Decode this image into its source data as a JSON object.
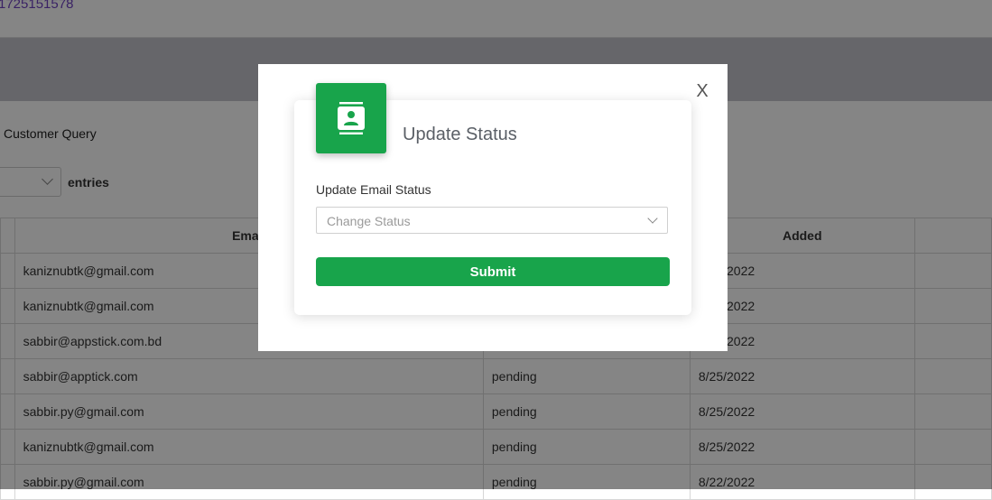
{
  "page": {
    "phone": "1725151578",
    "section_title": "Customer Query",
    "entries_label": "entries"
  },
  "table": {
    "headers": [
      "",
      "Email",
      "",
      "Added",
      ""
    ],
    "rows": [
      {
        "email": "kaniznubtk@gmail.com",
        "status": "",
        "added": "8/25/2022"
      },
      {
        "email": "kaniznubtk@gmail.com",
        "status": "",
        "added": "8/25/2022"
      },
      {
        "email": "sabbir@appstick.com.bd",
        "status": "",
        "added": "8/25/2022"
      },
      {
        "email": "sabbir@apptick.com",
        "status": "pending",
        "added": "8/25/2022"
      },
      {
        "email": "sabbir.py@gmail.com",
        "status": "pending",
        "added": "8/25/2022"
      },
      {
        "email": "kaniznubtk@gmail.com",
        "status": "pending",
        "added": "8/25/2022"
      },
      {
        "email": "sabbir.py@gmail.com",
        "status": "pending",
        "added": "8/22/2022"
      }
    ]
  },
  "modal": {
    "close_label": "X",
    "title": "Update Status",
    "field_label": "Update Email Status",
    "select_placeholder": "Change Status",
    "submit_label": "Submit",
    "icon": "contact-card-icon",
    "accent_color": "#18a44b"
  }
}
